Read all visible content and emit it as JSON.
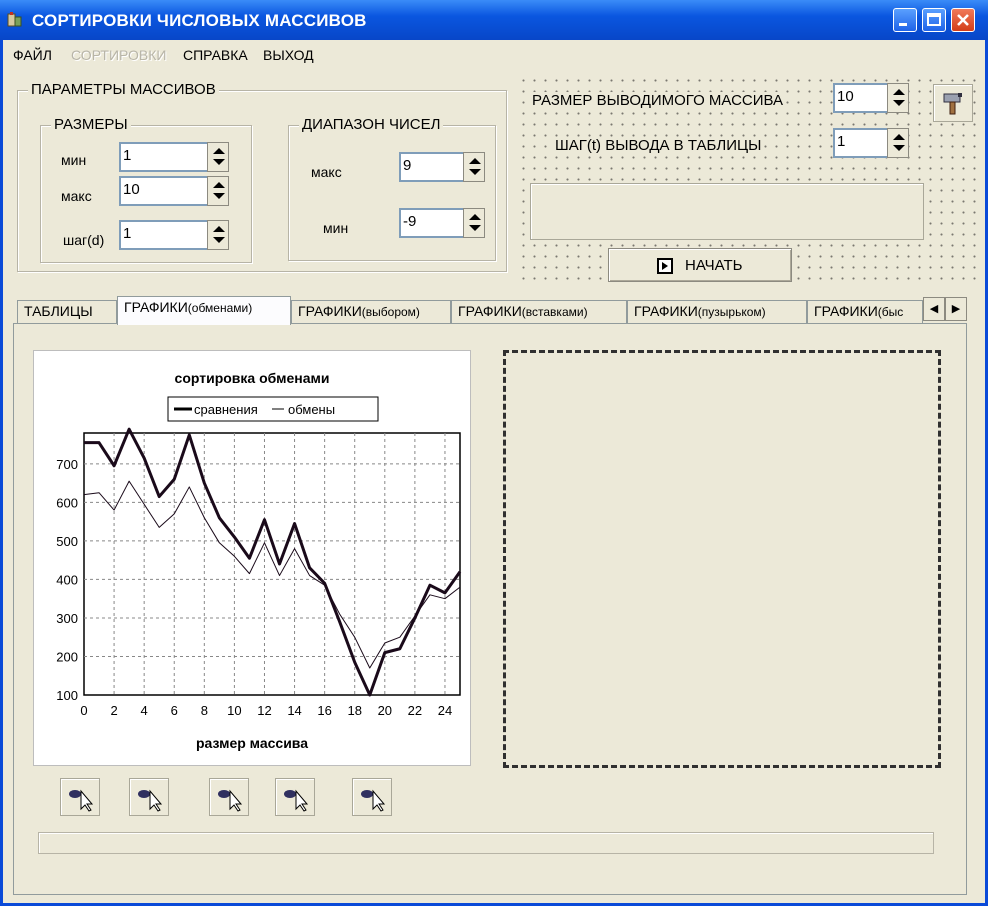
{
  "window": {
    "title": "СОРТИРОВКИ ЧИСЛОВЫХ МАССИВОВ",
    "title_bg": "#0a56e0"
  },
  "menu": [
    {
      "label": "ФАЙЛ",
      "enabled": true
    },
    {
      "label": "СОРТИРОВКИ",
      "enabled": false
    },
    {
      "label": "СПРАВКА",
      "enabled": true
    },
    {
      "label": "ВЫХОД",
      "enabled": true
    }
  ],
  "params": {
    "title": "ПАРАМЕТРЫ МАССИВОВ",
    "sizes": {
      "title": "РАЗМЕРЫ",
      "min_label": "мин",
      "min_value": "1",
      "max_label": "макс",
      "max_value": "10",
      "step_label": "шаг(d)",
      "step_value": "1"
    },
    "range": {
      "title": "ДИАПАЗОН ЧИСЕЛ",
      "max_label": "макс",
      "max_value": "9",
      "min_label": "мин",
      "min_value": "-9"
    }
  },
  "output": {
    "size_label": "РАЗМЕР ВЫВОДИМОГО МАССИВА",
    "size_value": "10",
    "step_label": "ШАГ(t) ВЫВОДА В ТАБЛИЦЫ",
    "step_value": "1"
  },
  "start_button": "НАЧАТЬ",
  "tabs": [
    {
      "main": "ТАБЛИЦЫ",
      "sub": ""
    },
    {
      "main": "ГРАФИКИ",
      "sub": "(обменами)",
      "active": true
    },
    {
      "main": "ГРАФИКИ",
      "sub": "(выбором)"
    },
    {
      "main": "ГРАФИКИ",
      "sub": "(вставками)"
    },
    {
      "main": "ГРАФИКИ",
      "sub": "(пузырьком)"
    },
    {
      "main": "ГРАФИКИ",
      "sub": "(быс"
    }
  ],
  "icons": {
    "app": "app-icon",
    "setup": "settings-hammer-icon",
    "small_buttons": [
      "cursor-pointer-icon",
      "cursor-pointer-icon",
      "cursor-pointer-icon",
      "cursor-pointer-icon",
      "cursor-pointer-icon"
    ]
  },
  "chart_data": {
    "type": "line",
    "title": "сортировка обменами",
    "xlabel": "размер массива",
    "ylabel": "",
    "xlim": [
      0,
      25
    ],
    "ylim": [
      100,
      780
    ],
    "xticks": [
      0,
      2,
      4,
      6,
      8,
      10,
      12,
      14,
      16,
      18,
      20,
      22,
      24
    ],
    "yticks": [
      100,
      200,
      300,
      400,
      500,
      600,
      700
    ],
    "grid": true,
    "legend_position": "top",
    "x": [
      0,
      1,
      2,
      3,
      4,
      5,
      6,
      7,
      8,
      9,
      10,
      11,
      12,
      13,
      14,
      15,
      16,
      17,
      18,
      19,
      20,
      21,
      22,
      23,
      24,
      25
    ],
    "series": [
      {
        "name": "сравнения",
        "color": "#1a0a1a",
        "width": 3,
        "values": [
          755,
          755,
          695,
          790,
          715,
          615,
          660,
          775,
          650,
          560,
          510,
          455,
          555,
          440,
          545,
          430,
          390,
          290,
          185,
          100,
          210,
          220,
          300,
          385,
          365,
          420
        ]
      },
      {
        "name": "обмены",
        "color": "#1a0a1a",
        "width": 1,
        "values": [
          620,
          625,
          580,
          655,
          595,
          535,
          570,
          640,
          560,
          495,
          460,
          415,
          495,
          410,
          480,
          410,
          385,
          310,
          250,
          170,
          235,
          250,
          305,
          360,
          350,
          380
        ]
      }
    ]
  }
}
